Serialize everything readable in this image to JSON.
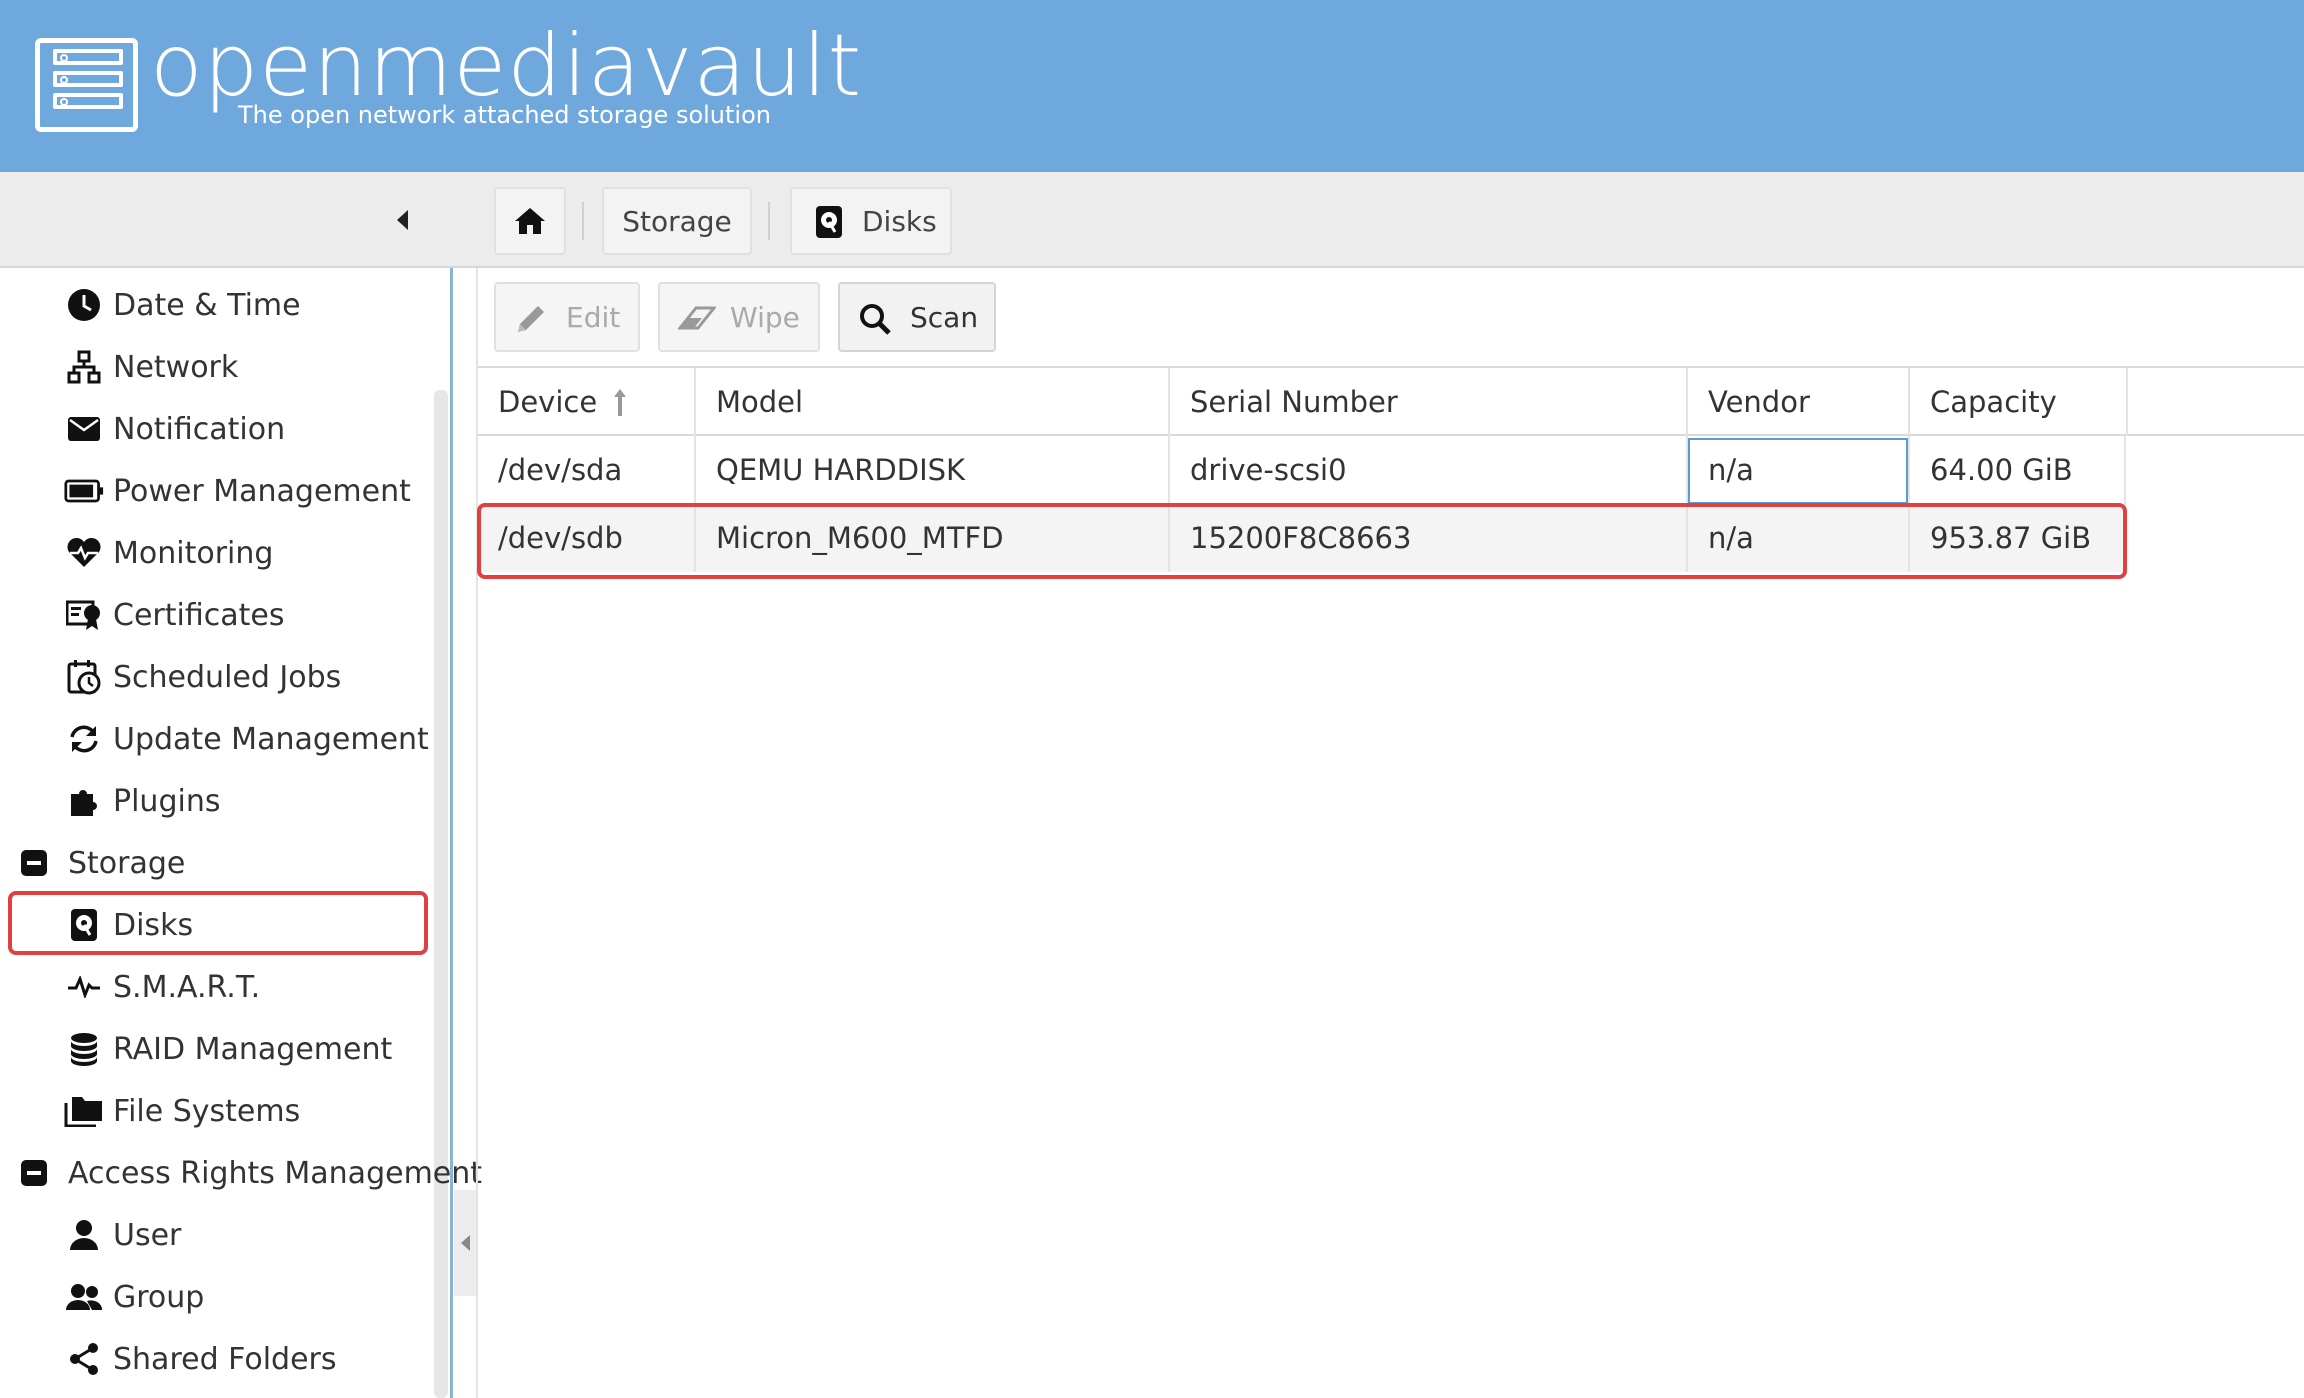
{
  "header": {
    "brand": "openmediavault",
    "tagline": "The open network attached storage solution",
    "background_color": "#6fa8dc"
  },
  "breadcrumb": {
    "home_icon": "home-icon",
    "items": [
      {
        "label": "Storage"
      },
      {
        "label": "Disks",
        "icon": "disk-icon"
      }
    ]
  },
  "sidebar": {
    "items": [
      {
        "label": "Date & Time",
        "icon": "clock-icon"
      },
      {
        "label": "Network",
        "icon": "network-icon"
      },
      {
        "label": "Notification",
        "icon": "envelope-icon"
      },
      {
        "label": "Power Management",
        "icon": "battery-icon"
      },
      {
        "label": "Monitoring",
        "icon": "heartbeat-icon"
      },
      {
        "label": "Certificates",
        "icon": "certificate-icon"
      },
      {
        "label": "Scheduled Jobs",
        "icon": "calendar-clock-icon"
      },
      {
        "label": "Update Management",
        "icon": "refresh-icon"
      },
      {
        "label": "Plugins",
        "icon": "puzzle-icon"
      },
      {
        "label": "Storage",
        "icon": "collapse-icon",
        "group": true
      },
      {
        "label": "Disks",
        "icon": "disk-icon",
        "selected": true
      },
      {
        "label": "S.M.A.R.T.",
        "icon": "pulse-icon"
      },
      {
        "label": "RAID Management",
        "icon": "database-icon"
      },
      {
        "label": "File Systems",
        "icon": "folders-icon"
      },
      {
        "label": "Access Rights Management",
        "icon": "collapse-icon",
        "group": true
      },
      {
        "label": "User",
        "icon": "user-icon"
      },
      {
        "label": "Group",
        "icon": "users-icon"
      },
      {
        "label": "Shared Folders",
        "icon": "share-icon"
      }
    ]
  },
  "toolbar": {
    "edit_label": "Edit",
    "wipe_label": "Wipe",
    "scan_label": "Scan"
  },
  "grid": {
    "columns": [
      "Device",
      "Model",
      "Serial Number",
      "Vendor",
      "Capacity"
    ],
    "sort_column": "Device",
    "sort_direction": "ascending",
    "rows": [
      {
        "device": "/dev/sda",
        "model": "QEMU HARDDISK",
        "serial": "drive-scsi0",
        "vendor": "n/a",
        "capacity": "64.00 GiB"
      },
      {
        "device": "/dev/sdb",
        "model": "Micron_M600_MTFD",
        "serial": "15200F8C8663",
        "vendor": "n/a",
        "capacity": "953.87 GiB"
      }
    ]
  },
  "highlight_color": "#e04040"
}
